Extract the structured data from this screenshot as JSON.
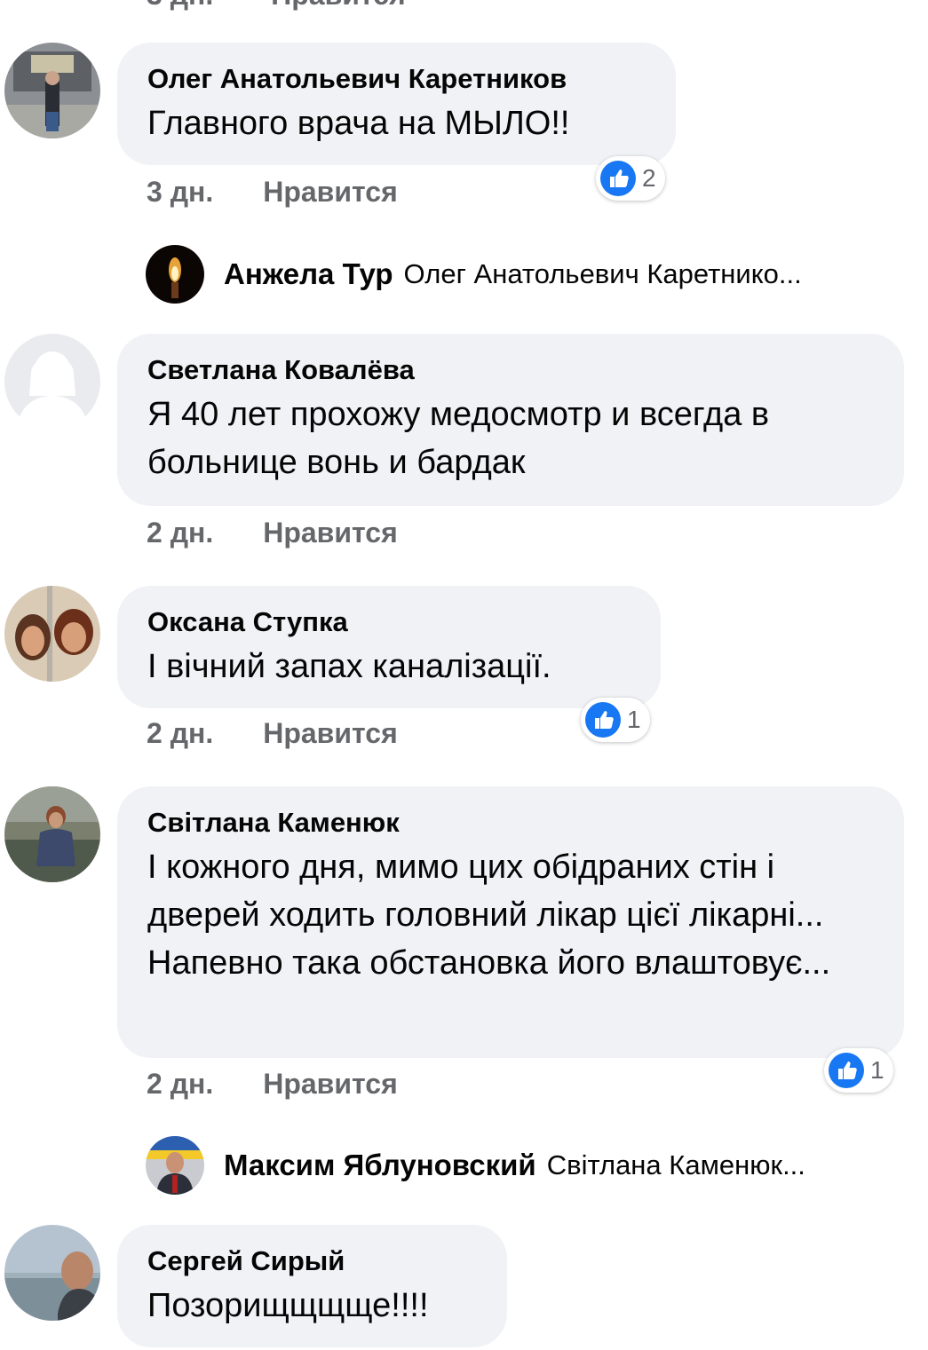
{
  "comments": [
    {
      "author": "Олег Анатольевич Каретников",
      "text": "Главного врача на МЫЛО!!",
      "time": "3 дн.",
      "like_label": "Нравится",
      "reactions": "2"
    },
    {
      "author": "Светлана Ковалёва",
      "text": "Я 40 лет прохожу медосмотр и всегда в больнице вонь и бардак",
      "time": "2 дн.",
      "like_label": "Нравится"
    },
    {
      "author": "Оксана Ступка",
      "text": "І вічний запах каналізації.",
      "time": "2 дн.",
      "like_label": "Нравится",
      "reactions": "1"
    },
    {
      "author": "Світлана Каменюк",
      "text": "І кожного дня, мимо цих обідраних стін і дверей ходить головний лікар цієї лікарні... Напевно така обстановка його влаштовує...",
      "time": "2 дн.",
      "like_label": "Нравится",
      "reactions": "1"
    },
    {
      "author": "Сергей Сирый",
      "text": "Позорищщщще!!!!"
    }
  ],
  "replies": [
    {
      "author": "Анжела Тур",
      "snippet": "Олег Анатольевич Каретнико..."
    },
    {
      "author": "Максим Яблуновский",
      "snippet": "Світлана Каменюк..."
    }
  ],
  "top_partial": {
    "time": "3 дн.",
    "like_label": "Нравится"
  },
  "colors": {
    "bubble": "#f0f2f5",
    "meta_text": "#65676b",
    "like_blue": "#1877f2"
  }
}
